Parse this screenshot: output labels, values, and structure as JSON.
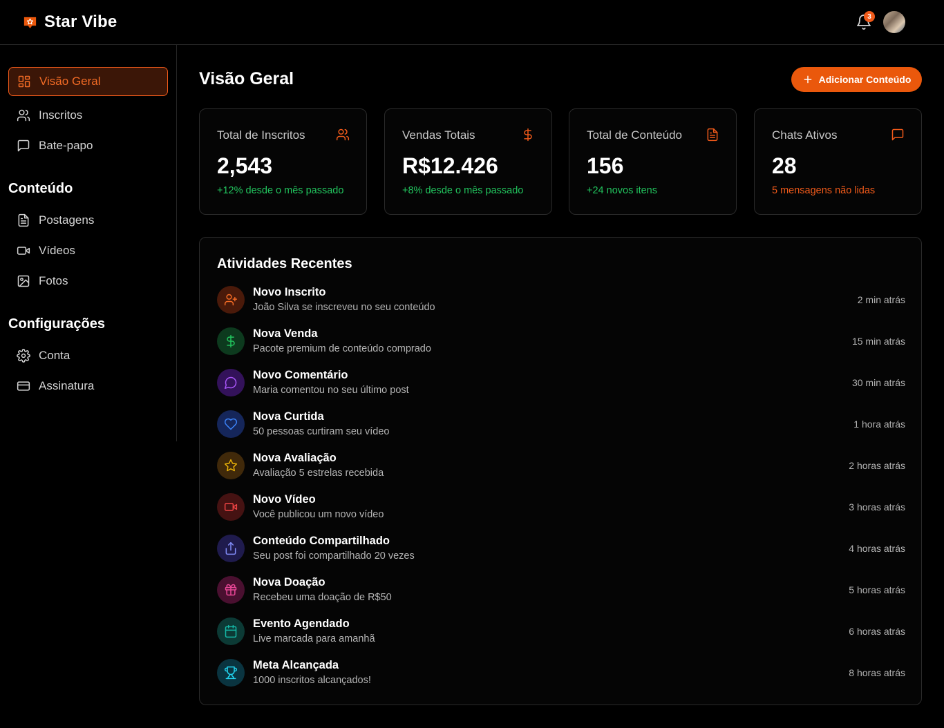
{
  "app": {
    "name": "Star Vibe",
    "notifications_count": "3"
  },
  "sidebar": {
    "main_items": [
      {
        "label": "Visão Geral",
        "icon": "layout-grid-icon",
        "active": true
      },
      {
        "label": "Inscritos",
        "icon": "users-icon"
      },
      {
        "label": "Bate-papo",
        "icon": "message-square-icon"
      }
    ],
    "sections": [
      {
        "title": "Conteúdo",
        "items": [
          {
            "label": "Postagens",
            "icon": "file-text-icon"
          },
          {
            "label": "Vídeos",
            "icon": "video-icon"
          },
          {
            "label": "Fotos",
            "icon": "image-icon"
          }
        ]
      },
      {
        "title": "Configurações",
        "items": [
          {
            "label": "Conta",
            "icon": "gear-icon"
          },
          {
            "label": "Assinatura",
            "icon": "credit-card-icon"
          }
        ]
      }
    ]
  },
  "main": {
    "title": "Visão Geral",
    "add_button_label": "Adicionar Conteúdo",
    "stats": [
      {
        "label": "Total de Inscritos",
        "value": "2,543",
        "sub": "+12% desde o mês passado",
        "icon": "users-icon",
        "sub_color": "#22c55e"
      },
      {
        "label": "Vendas Totais",
        "value": "R$12.426",
        "sub": "+8% desde o mês passado",
        "icon": "dollar-icon",
        "sub_color": "#22c55e"
      },
      {
        "label": "Total de Conteúdo",
        "value": "156",
        "sub": "+24 novos itens",
        "icon": "file-text-icon",
        "sub_color": "#22c55e"
      },
      {
        "label": "Chats Ativos",
        "value": "28",
        "sub": "5 mensagens não lidas",
        "icon": "message-square-icon",
        "sub_color": "#f05a1a"
      }
    ],
    "activity": {
      "title": "Atividades Recentes",
      "items": [
        {
          "title": "Novo Inscrito",
          "desc": "João Silva se inscreveu no seu conteúdo",
          "time": "2 min atrás",
          "icon": "user-plus-icon",
          "color": "#f26b25"
        },
        {
          "title": "Nova Venda",
          "desc": "Pacote premium de conteúdo comprado",
          "time": "15 min atrás",
          "icon": "dollar-icon",
          "color": "#22c55e"
        },
        {
          "title": "Novo Comentário",
          "desc": "Maria comentou no seu último post",
          "time": "30 min atrás",
          "icon": "message-circle-icon",
          "color": "#a855f7"
        },
        {
          "title": "Nova Curtida",
          "desc": "50 pessoas curtiram seu vídeo",
          "time": "1 hora atrás",
          "icon": "heart-icon",
          "color": "#3b82f6"
        },
        {
          "title": "Nova Avaliação",
          "desc": "Avaliação 5 estrelas recebida",
          "time": "2 horas atrás",
          "icon": "star-icon",
          "color": "#eab308"
        },
        {
          "title": "Novo Vídeo",
          "desc": "Você publicou um novo vídeo",
          "time": "3 horas atrás",
          "icon": "video-icon",
          "color": "#ef4444"
        },
        {
          "title": "Conteúdo Compartilhado",
          "desc": "Seu post foi compartilhado 20 vezes",
          "time": "4 horas atrás",
          "icon": "share-icon",
          "color": "#6366f1"
        },
        {
          "title": "Nova Doação",
          "desc": "Recebeu uma doação de R$50",
          "time": "5 horas atrás",
          "icon": "gift-icon",
          "color": "#ec4899"
        },
        {
          "title": "Evento Agendado",
          "desc": "Live marcada para amanhã",
          "time": "6 horas atrás",
          "icon": "calendar-icon",
          "color": "#14b8a6"
        },
        {
          "title": "Meta Alcançada",
          "desc": "1000 inscritos alcançados!",
          "time": "8 horas atrás",
          "icon": "trophy-icon",
          "color": "#06b6d4"
        }
      ]
    }
  }
}
